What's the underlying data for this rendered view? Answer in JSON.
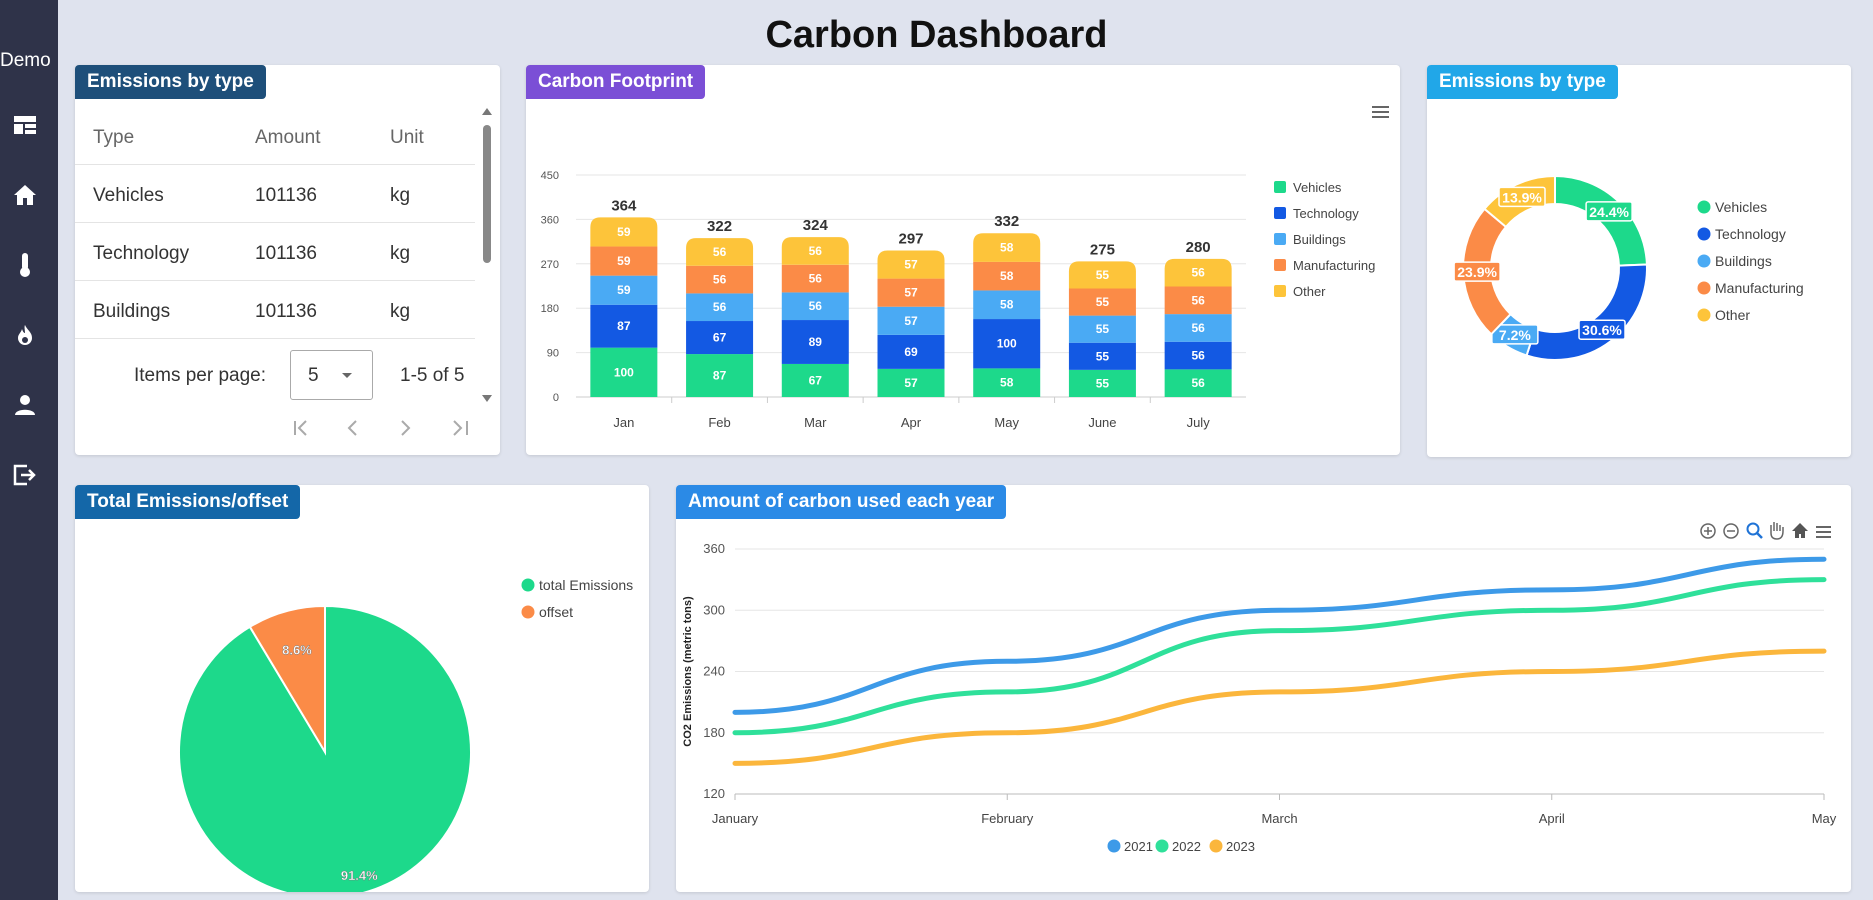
{
  "app": {
    "brand": "Demo",
    "title": "Carbon Dashboard"
  },
  "sidebar": {
    "items": [
      {
        "icon": "dashboard-icon"
      },
      {
        "icon": "home-icon"
      },
      {
        "icon": "thermometer-icon"
      },
      {
        "icon": "fire-icon"
      },
      {
        "icon": "user-icon"
      },
      {
        "icon": "logout-icon"
      }
    ]
  },
  "emissions_table": {
    "title": "Emissions by type",
    "columns": [
      "Type",
      "Amount",
      "Unit"
    ],
    "rows": [
      [
        "Vehicles",
        "101136",
        "kg"
      ],
      [
        "Technology",
        "101136",
        "kg"
      ],
      [
        "Buildings",
        "101136",
        "kg"
      ]
    ],
    "items_per_page_label": "Items per page:",
    "items_per_page_value": "5",
    "range": "1-5 of 5"
  },
  "footprint": {
    "title": "Carbon Footprint"
  },
  "donut": {
    "title": "Emissions by type"
  },
  "pie": {
    "title": "Total Emissions/offset"
  },
  "yearly": {
    "title": "Amount of carbon used each year"
  },
  "colors": {
    "vehicles": "#1dd98b",
    "technology": "#1359e3",
    "buildings": "#4aaaf4",
    "manufacturing": "#fb8b47",
    "other": "#fdc43a",
    "badge_table": "#1e4f7a",
    "badge_footprint": "#7b4fd6",
    "badge_donut": "#21a7e8",
    "badge_pie": "#1467a8",
    "badge_yearly": "#2b8ae6",
    "sidebar": "#2f3349"
  },
  "chart_data": [
    {
      "type": "bar",
      "stacked": true,
      "title": "",
      "categories": [
        "Jan",
        "Feb",
        "Mar",
        "Apr",
        "May",
        "June",
        "July"
      ],
      "series": [
        {
          "name": "Vehicles",
          "color": "#1dd98b",
          "values": [
            100,
            87,
            67,
            57,
            58,
            55,
            56
          ]
        },
        {
          "name": "Technology",
          "color": "#1359e3",
          "values": [
            87,
            67,
            89,
            69,
            100,
            55,
            56
          ]
        },
        {
          "name": "Buildings",
          "color": "#4aaaf4",
          "values": [
            59,
            56,
            56,
            57,
            58,
            55,
            56
          ]
        },
        {
          "name": "Manufacturing",
          "color": "#fb8b47",
          "values": [
            59,
            56,
            56,
            57,
            58,
            55,
            56
          ]
        },
        {
          "name": "Other",
          "color": "#fdc43a",
          "values": [
            59,
            56,
            56,
            57,
            58,
            55,
            56
          ]
        }
      ],
      "totals": [
        364,
        322,
        324,
        297,
        332,
        275,
        280
      ],
      "yticks": [
        0,
        90,
        180,
        270,
        360,
        450
      ],
      "ylim": [
        0,
        450
      ],
      "legend": "right",
      "grid": true
    },
    {
      "type": "pie",
      "donut": true,
      "slices": [
        {
          "name": "Vehicles",
          "color": "#1dd98b",
          "value": 24.4,
          "label": "24.4%"
        },
        {
          "name": "Technology",
          "color": "#1359e3",
          "value": 30.6,
          "label": "30.6%"
        },
        {
          "name": "Buildings",
          "color": "#4aaaf4",
          "value": 7.2,
          "label": "7.2%"
        },
        {
          "name": "Manufacturing",
          "color": "#fb8b47",
          "value": 23.9,
          "label": "23.9%"
        },
        {
          "name": "Other",
          "color": "#fdc43a",
          "value": 13.9,
          "label": "13.9%"
        }
      ],
      "legend": "right"
    },
    {
      "type": "pie",
      "slices": [
        {
          "name": "total Emissions",
          "color": "#1dd98b",
          "value": 91.4,
          "label": "91.4%"
        },
        {
          "name": "offset",
          "color": "#fb8b47",
          "value": 8.6,
          "label": "8.6%"
        }
      ],
      "legend": "top-right"
    },
    {
      "type": "line",
      "smooth": true,
      "categories": [
        "January",
        "February",
        "March",
        "April",
        "May"
      ],
      "series": [
        {
          "name": "2021",
          "color": "#3d9ae8",
          "values": [
            200,
            250,
            300,
            320,
            350
          ]
        },
        {
          "name": "2022",
          "color": "#2fe09a",
          "values": [
            180,
            220,
            280,
            300,
            330
          ]
        },
        {
          "name": "2023",
          "color": "#fbb63c",
          "values": [
            150,
            180,
            220,
            240,
            260
          ]
        }
      ],
      "ylabel": "CO2 Emissions (metric tons)",
      "yticks": [
        120,
        180,
        240,
        300,
        360
      ],
      "ylim": [
        120,
        360
      ],
      "legend": "bottom",
      "grid": true
    }
  ]
}
